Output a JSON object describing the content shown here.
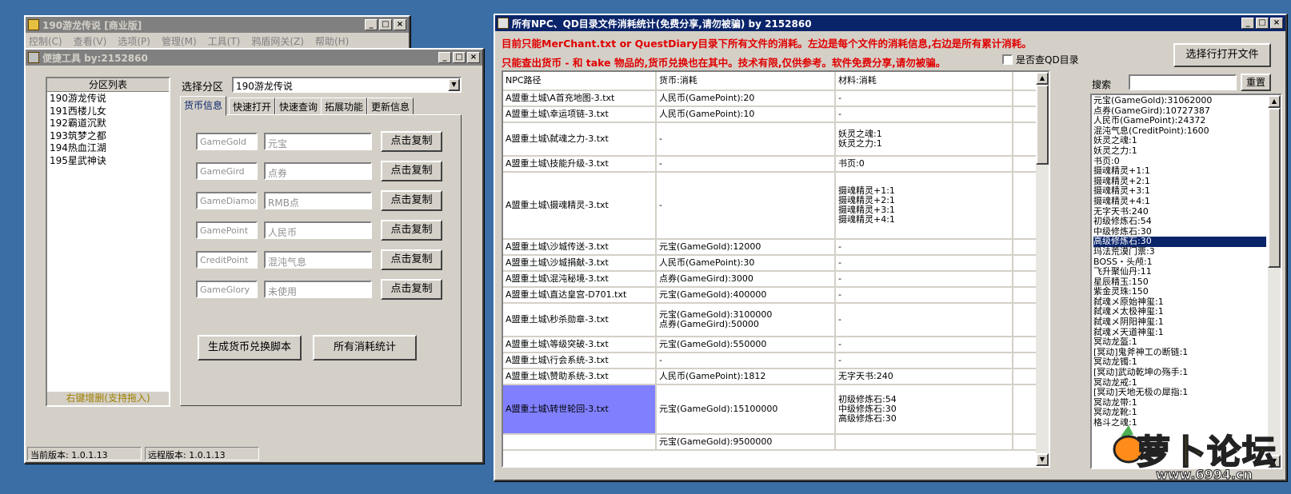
{
  "main_window": {
    "title": "190游龙传说 [商业版]",
    "menu": [
      "控制(C)",
      "查看(V)",
      "选项(P)",
      "管理(M)",
      "工具(T)",
      "鸦盾网关(Z)",
      "帮助(H)"
    ]
  },
  "tool_window": {
    "title": "便捷工具  by:2152860",
    "partition_list_header": "分区列表",
    "partitions": [
      "190游龙传说",
      "191西楼儿女",
      "192霸道沉默",
      "193筑梦之都",
      "194热血江湖",
      "195星武神诀"
    ],
    "partition_footer": "右键增删(支持拖入)",
    "select_label": "选择分区",
    "select_value": "190游龙传说",
    "tabs": [
      "货币信息",
      "快速打开",
      "快速查询",
      "拓展功能",
      "更新信息"
    ],
    "currencies": [
      {
        "key": "GameGold",
        "name": "元宝",
        "button": "点击复制"
      },
      {
        "key": "GameGird",
        "name": "点券",
        "button": "点击复制"
      },
      {
        "key": "GameDiamond",
        "name": "RMB点",
        "button": "点击复制"
      },
      {
        "key": "GamePoint",
        "name": "人民币",
        "button": "点击复制"
      },
      {
        "key": "CreditPoint",
        "name": "混沌气息",
        "button": "点击复制"
      },
      {
        "key": "GameGlory",
        "name": "未使用",
        "button": "点击复制"
      }
    ],
    "generate_button": "生成货币兑换脚本",
    "stats_button": "所有消耗统计",
    "status_current": "当前版本: 1.0.1.13",
    "status_remote": "远程版本: 1.0.1.13"
  },
  "stats_window": {
    "title": "所有NPC、QD目录文件消耗统计(免费分享,请勿被骗)     by 2152860",
    "notice1": "目前只能MerChant.txt or QuestDiary目录下所有文件的消耗。左边是每个文件的消耗信息,右边是所有累计消耗。",
    "notice2": "只能查出货币 - 和 take 物品的,货币兑换也在其中。技术有限,仅供参考。软件免费分享,请勿被骗。",
    "qd_checkbox": "是否查QD目录",
    "open_button": "选择行打开文件",
    "search_label": "搜索",
    "reset_button": "重置",
    "columns": [
      "NPC路径",
      "货币:消耗",
      "材料:消耗"
    ],
    "rows": [
      {
        "path": "A盟重土城\\A首充地图-3.txt",
        "currency": "人民币(GamePoint):20",
        "material": "-"
      },
      {
        "path": "A盟重土城\\幸运项链-3.txt",
        "currency": "人民币(GamePoint):10",
        "material": "-"
      },
      {
        "path": "A盟重土城\\弑魂之力-3.txt",
        "currency": "-",
        "material": "妖灵之魂:1\n妖灵之力:1"
      },
      {
        "path": "A盟重土城\\技能升级-3.txt",
        "currency": "-",
        "material": "书页:0"
      },
      {
        "path": "A盟重土城\\摄魂精灵-3.txt",
        "currency": "-",
        "material": "摄魂精灵+1:1\n摄魂精灵+2:1\n摄魂精灵+3:1\n摄魂精灵+4:1"
      },
      {
        "path": "A盟重土城\\沙城传送-3.txt",
        "currency": "元宝(GameGold):12000",
        "material": "-"
      },
      {
        "path": "A盟重土城\\沙城捐献-3.txt",
        "currency": "人民币(GamePoint):30",
        "material": "-"
      },
      {
        "path": "A盟重土城\\混沌秘境-3.txt",
        "currency": "点券(GameGird):3000",
        "material": "-"
      },
      {
        "path": "A盟重土城\\直达皇宫-D701.txt",
        "currency": "元宝(GameGold):400000",
        "material": "-"
      },
      {
        "path": "A盟重土城\\秒杀勋章-3.txt",
        "currency": "元宝(GameGold):3100000\n点券(GameGird):50000",
        "material": "-"
      },
      {
        "path": "A盟重土城\\等级突破-3.txt",
        "currency": "元宝(GameGold):550000",
        "material": "-"
      },
      {
        "path": "A盟重土城\\行会系统-3.txt",
        "currency": "-",
        "material": "-"
      },
      {
        "path": "A盟重土城\\赞助系统-3.txt",
        "currency": "人民币(GamePoint):1812",
        "material": "无字天书:240"
      },
      {
        "path": "A盟重土城\\转世轮回-3.txt",
        "currency": "元宝(GameGold):15100000",
        "material": "初级修炼石:54\n中级修炼石:30\n高级修炼石:30"
      },
      {
        "path": "",
        "currency": "元宝(GameGold):9500000",
        "material": ""
      }
    ],
    "totals": [
      "元宝(GameGold):31062000",
      "点券(GameGird):10727387",
      "人民币(GamePoint):24372",
      "混沌气息(CreditPoint):1600",
      "妖灵之魂:1",
      "妖灵之力:1",
      "书页:0",
      "摄魂精灵+1:1",
      "摄魂精灵+2:1",
      "摄魂精灵+3:1",
      "摄魂精灵+4:1",
      "无字天书:240",
      "初级修炼石:54",
      "中级修炼石:30",
      "高级修炼石:30",
      "玛法荒漠门票:3",
      "BOSS・头颅:1",
      "飞升聚仙丹:11",
      "星辰精玉:150",
      "紫金灵珠:150",
      "弑魂メ原始神玺:1",
      "弑魂メ太极神玺:1",
      "弑魂メ阴阳神玺:1",
      "弑魂メ天道神玺:1",
      "冥动龙盔:1",
      "[冥动]鬼斧神工の断链:1",
      "冥动龙镯:1",
      "[冥动]武动乾坤の殇手:1",
      "冥动龙戒:1",
      "[冥动]天地无极の犀指:1",
      "冥动龙带:1",
      "冥动龙靴:1",
      "格斗之魂:1"
    ],
    "totals_selected_index": 14
  },
  "watermark": {
    "text": "萝卜论坛",
    "url": "www.6994.cn"
  }
}
